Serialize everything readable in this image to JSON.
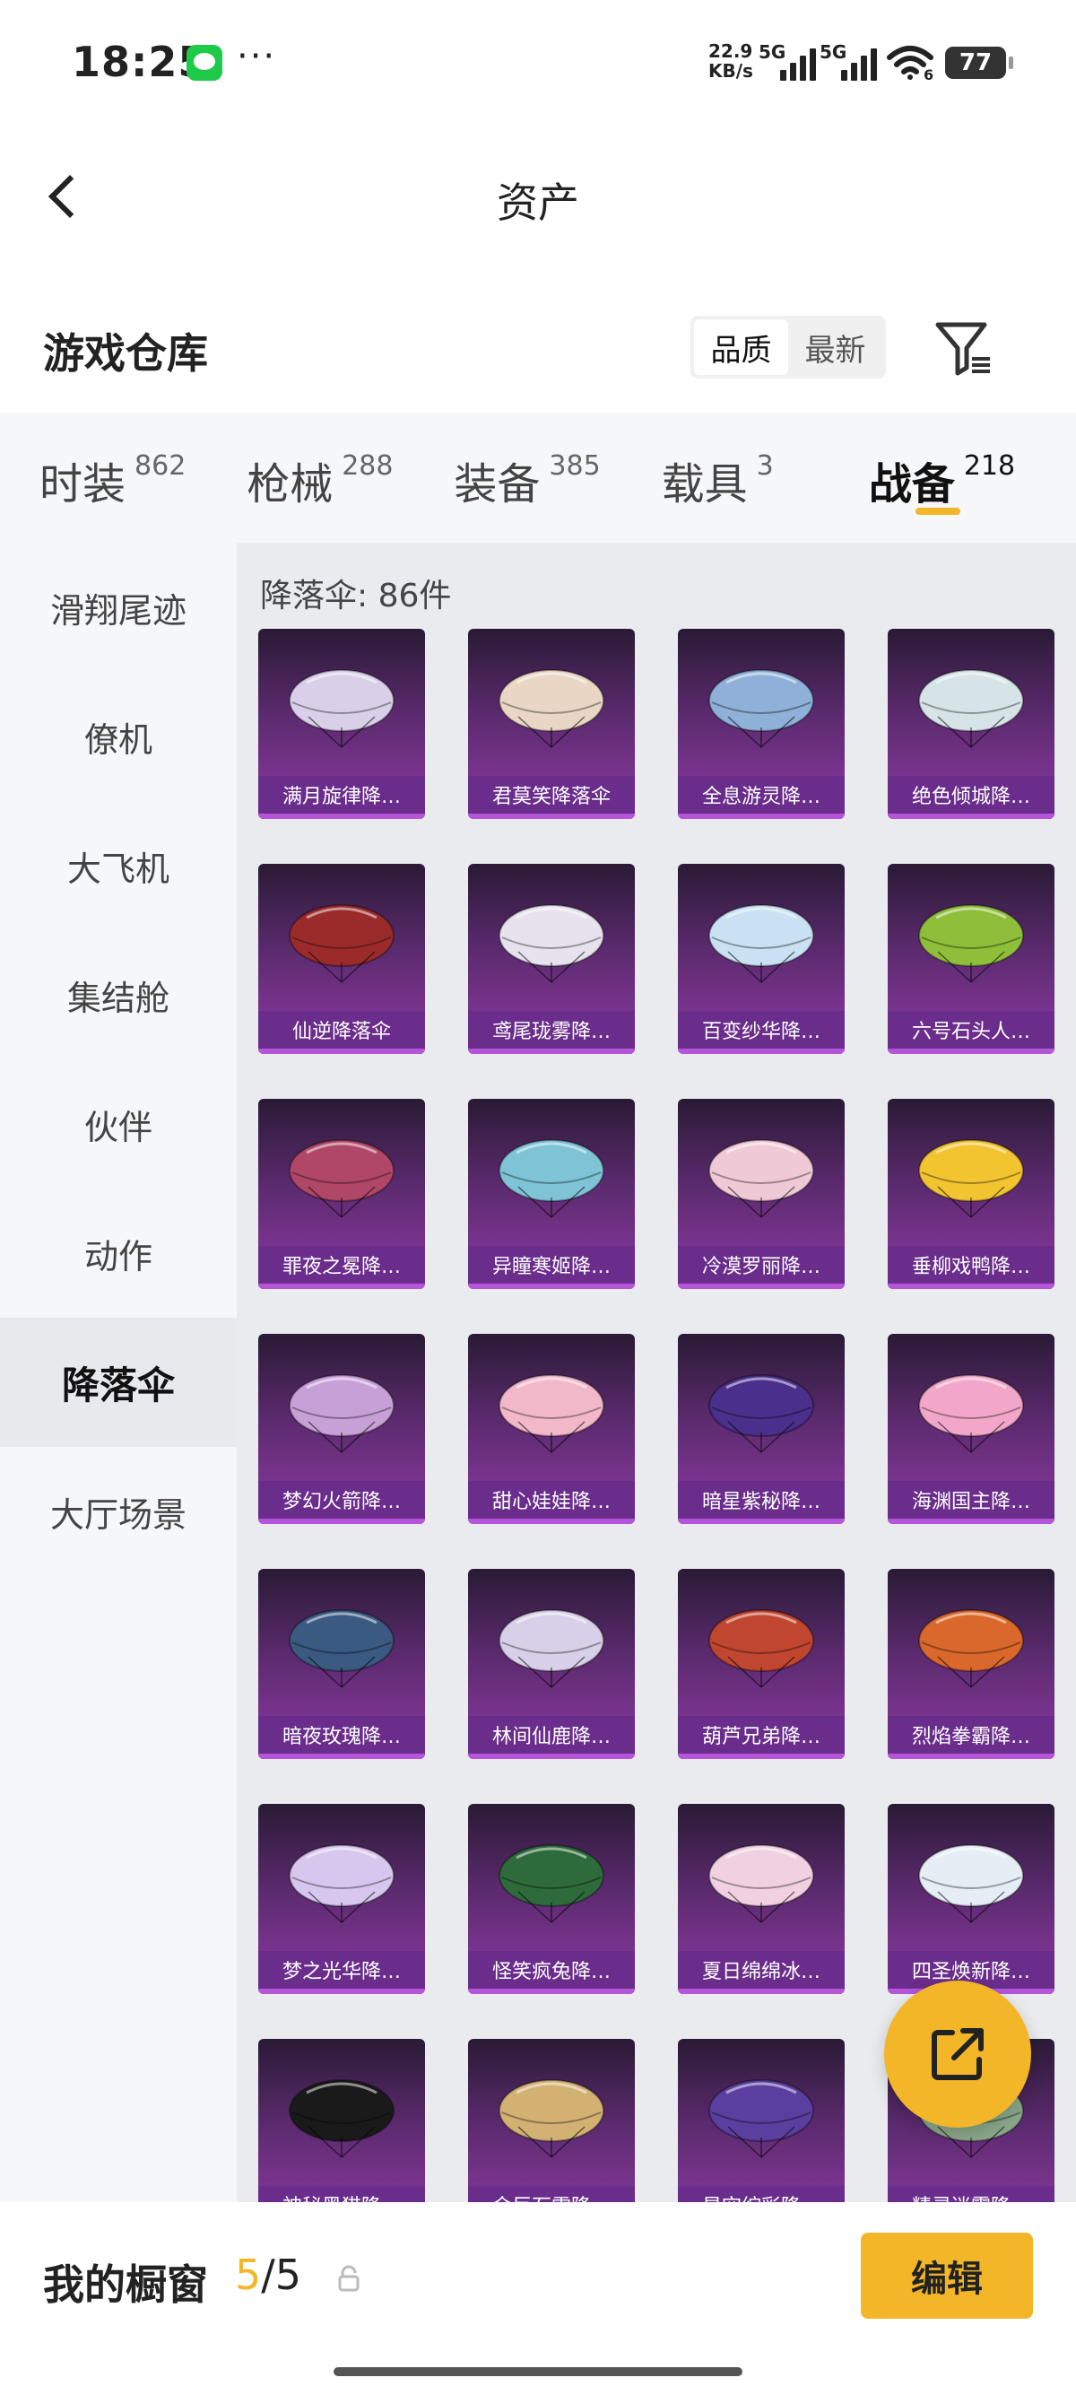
{
  "status_bar": {
    "time": "18:25",
    "dots": "···",
    "net_speed_value": "22.9",
    "net_speed_unit": "KB/s",
    "sim1_label": "5G",
    "sim2_label": "5G",
    "wifi_sub": "6",
    "battery": "77"
  },
  "nav": {
    "title": "资产"
  },
  "section": {
    "title": "游戏仓库",
    "sort_quality": "品质",
    "sort_newest": "最新"
  },
  "tabs": [
    {
      "label": "时装",
      "count": "862"
    },
    {
      "label": "枪械",
      "count": "288"
    },
    {
      "label": "装备",
      "count": "385"
    },
    {
      "label": "载具",
      "count": "3"
    },
    {
      "label": "战备",
      "count": "218"
    }
  ],
  "sidebar": {
    "items": [
      "滑翔尾迹",
      "僚机",
      "大飞机",
      "集结舱",
      "伙伴",
      "动作",
      "降落伞",
      "大厅场景"
    ],
    "active": "降落伞"
  },
  "content": {
    "count_label": "降落伞: 86件",
    "items": [
      "满月旋律降…",
      "君莫笑降落伞",
      "全息游灵降…",
      "绝色倾城降…",
      "仙逆降落伞",
      "鸢尾珑雾降…",
      "百变纱华降…",
      "六号石头人…",
      "罪夜之冕降…",
      "异瞳寒姬降…",
      "冷漠罗丽降…",
      "垂柳戏鸭降…",
      "梦幻火箭降…",
      "甜心娃娃降…",
      "暗星紫秘降…",
      "海渊国主降…",
      "暗夜玫瑰降…",
      "林间仙鹿降…",
      "葫芦兄弟降…",
      "烈焰拳霸降…",
      "梦之光华降…",
      "怪笑疯兔降…",
      "夏日绵绵冰…",
      "四圣焕新降…",
      "神秘黑猫降…",
      "金巨石雷降…",
      "星空绽彩降…",
      "精灵迷雾降…"
    ],
    "palette": [
      "#d9cfe9",
      "#e9d6c4",
      "#8fb0d8",
      "#d6e4e8",
      "#9b2b2b",
      "#e6e2ee",
      "#c9e1f2",
      "#8fbf3a",
      "#b14767",
      "#7ec3d6",
      "#f0c9d7",
      "#f2c430",
      "#c7a0d8",
      "#f1b8c9",
      "#4a2f8c",
      "#f2a7c9",
      "#3a5a82",
      "#d8d0e8",
      "#c0462f",
      "#d9682a",
      "#d7c7ef",
      "#2e6b3b",
      "#f1d1e1",
      "#e6eef5",
      "#1a1a1a",
      "#d2b173",
      "#5a3fa0",
      "#8aa78a"
    ]
  },
  "bottom": {
    "label": "我的橱窗",
    "slots_current": "5",
    "slots_sep": "/",
    "slots_total": "5",
    "edit_label": "编辑"
  },
  "colors": {
    "accent": "#f2b628",
    "card_bottom": "#6a2d8c",
    "sidebar_bg": "#f6f7f9",
    "content_bg": "#e9ebee"
  }
}
